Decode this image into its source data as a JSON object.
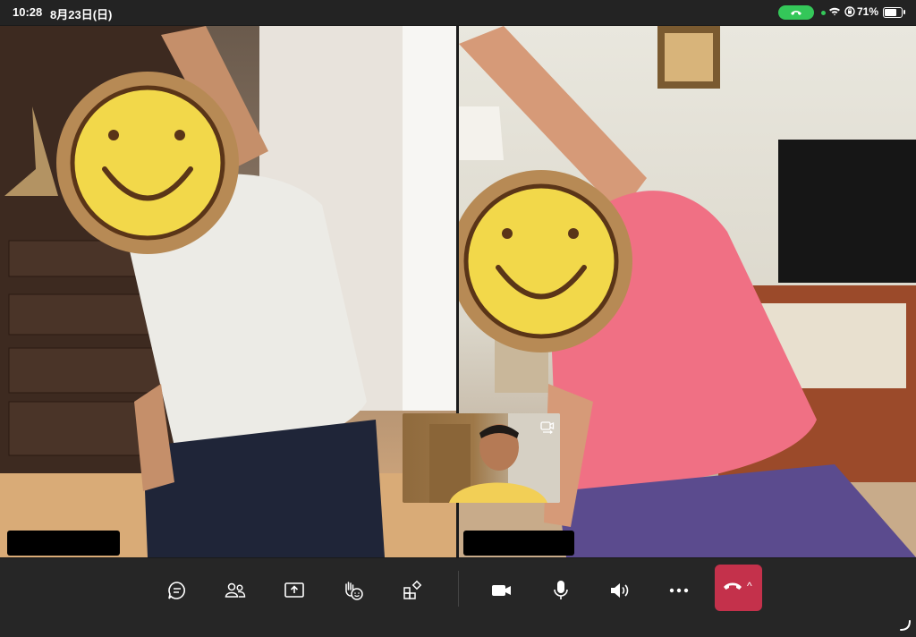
{
  "status_bar": {
    "time": "10:28",
    "date": "8月23日(日)",
    "battery_percent": "71%",
    "battery_level": 0.71,
    "call_pill_color": "#34c759"
  },
  "video_tiles": {
    "left": {
      "description_icon": "smiley-face-sticker"
    },
    "right": {
      "description_icon": "smiley-face-sticker"
    },
    "self_view": {
      "switch_camera_icon": "switch-camera-icon"
    }
  },
  "toolbar": {
    "buttons": [
      {
        "icon": "chat-icon"
      },
      {
        "icon": "participants-icon"
      },
      {
        "icon": "share-screen-icon"
      },
      {
        "icon": "raise-hand-reactions-icon"
      },
      {
        "icon": "apps-icon"
      },
      {
        "icon": "camera-icon"
      },
      {
        "icon": "microphone-icon"
      },
      {
        "icon": "speaker-icon"
      },
      {
        "icon": "more-options-icon"
      }
    ],
    "hangup": {
      "icon": "end-call-icon",
      "color": "#c4314b",
      "caret": "^"
    }
  }
}
